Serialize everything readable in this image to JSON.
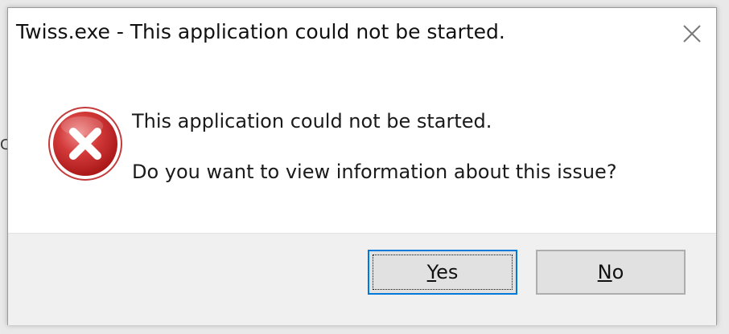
{
  "window": {
    "title": "Twiss.exe - This application could not be started."
  },
  "message": {
    "line1": "This application could not be started.",
    "line2": "Do you want to view information about this issue?"
  },
  "icon": {
    "name": "error-icon",
    "color": "#d32f2f"
  },
  "buttons": {
    "yes_mnemonic": "Y",
    "yes_rest": "es",
    "no_mnemonic": "N",
    "no_rest": "o"
  },
  "background": {
    "glyphs": [
      "C"
    ]
  }
}
